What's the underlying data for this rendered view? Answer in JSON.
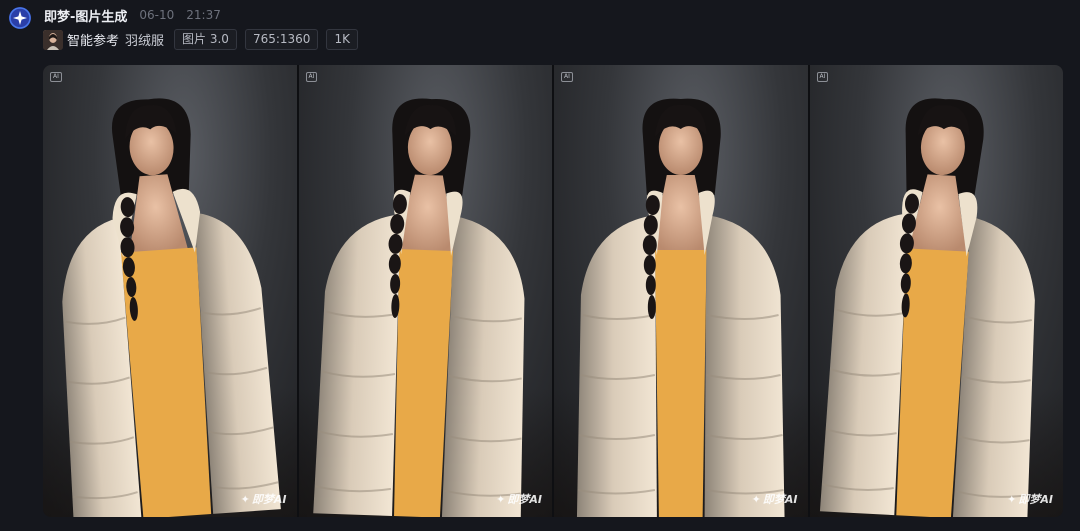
{
  "header": {
    "app_name": "即梦-图片生成",
    "date": "06-10",
    "time": "21:37"
  },
  "tags": {
    "reference_label": "智能参考",
    "prompt": "羽绒服",
    "model": "图片 3.0",
    "ratio": "765:1360",
    "resolution": "1K"
  },
  "images": [
    {
      "ai_badge": "AI",
      "watermark": "即梦AI"
    },
    {
      "ai_badge": "AI",
      "watermark": "即梦AI"
    },
    {
      "ai_badge": "AI",
      "watermark": "即梦AI"
    },
    {
      "ai_badge": "AI",
      "watermark": "即梦AI"
    }
  ],
  "colors": {
    "background": "#15171d",
    "avatar_blue": "#2b3fa8",
    "coat": "#d9cbb8",
    "dress": "#e8a948"
  },
  "icons": {
    "avatar": "sparkle-icon",
    "reference": "reference-thumbnail",
    "watermark": "jimeng-logo-icon"
  }
}
